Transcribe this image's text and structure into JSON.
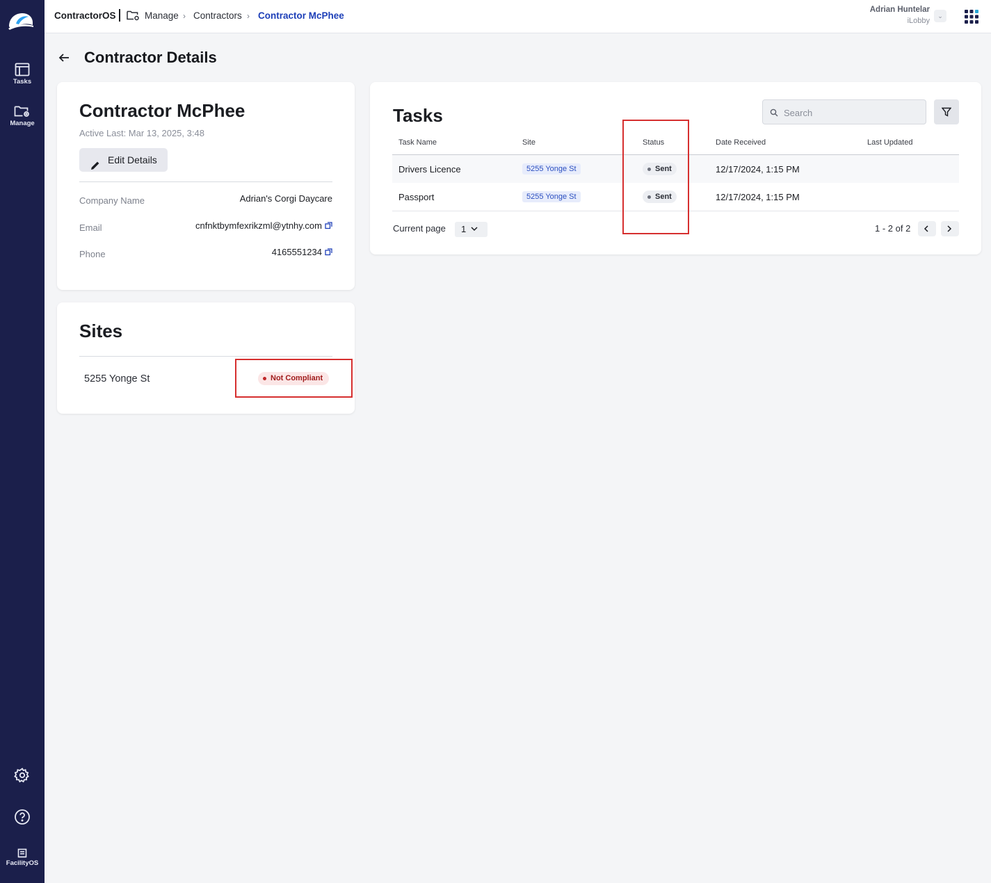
{
  "app": {
    "brand": "ContractorOS"
  },
  "sidebar": {
    "items": [
      {
        "label": "Tasks",
        "icon": "tasks-icon"
      },
      {
        "label": "Manage",
        "icon": "folder-gear-icon"
      }
    ],
    "footer_label": "FacilityOS"
  },
  "breadcrumb": [
    "Manage",
    "Contractors",
    "Contractor McPhee"
  ],
  "user": {
    "name": "Adrian Huntelar",
    "org": "iLobby"
  },
  "page": {
    "title": "Contractor Details"
  },
  "contractor": {
    "name": "Contractor McPhee",
    "active_last": "Active Last: Mar 13, 2025, 3:48",
    "edit_label": "Edit Details",
    "fields": [
      {
        "label": "Company Name",
        "value": "Adrian's Corgi Daycare"
      },
      {
        "label": "Email",
        "value": "cnfnktbymfexrikzml@ytnhy.com"
      },
      {
        "label": "Phone",
        "value": "4165551234"
      }
    ]
  },
  "sites": {
    "title": "Sites",
    "items": [
      {
        "name": "5255 Yonge St",
        "status": "Not Compliant"
      }
    ]
  },
  "tasks": {
    "title": "Tasks",
    "search_placeholder": "Search",
    "columns": [
      "Task Name",
      "Site",
      "Status",
      "Date Received",
      "Last Updated"
    ],
    "rows": [
      {
        "name": "Drivers Licence",
        "site": "5255 Yonge St",
        "status": "Sent",
        "date_received": "12/17/2024, 1:15 PM",
        "last_updated": ""
      },
      {
        "name": "Passport",
        "site": "5255 Yonge St",
        "status": "Sent",
        "date_received": "12/17/2024, 1:15 PM",
        "last_updated": ""
      }
    ],
    "pagination": {
      "label": "Current page",
      "current": "1",
      "range": "1 - 2 of 2"
    }
  },
  "colors": {
    "sidebar": "#1b1f4b",
    "accent": "#1d3fb8",
    "highlight": "#d62f2f",
    "danger": "#a11d1d"
  }
}
